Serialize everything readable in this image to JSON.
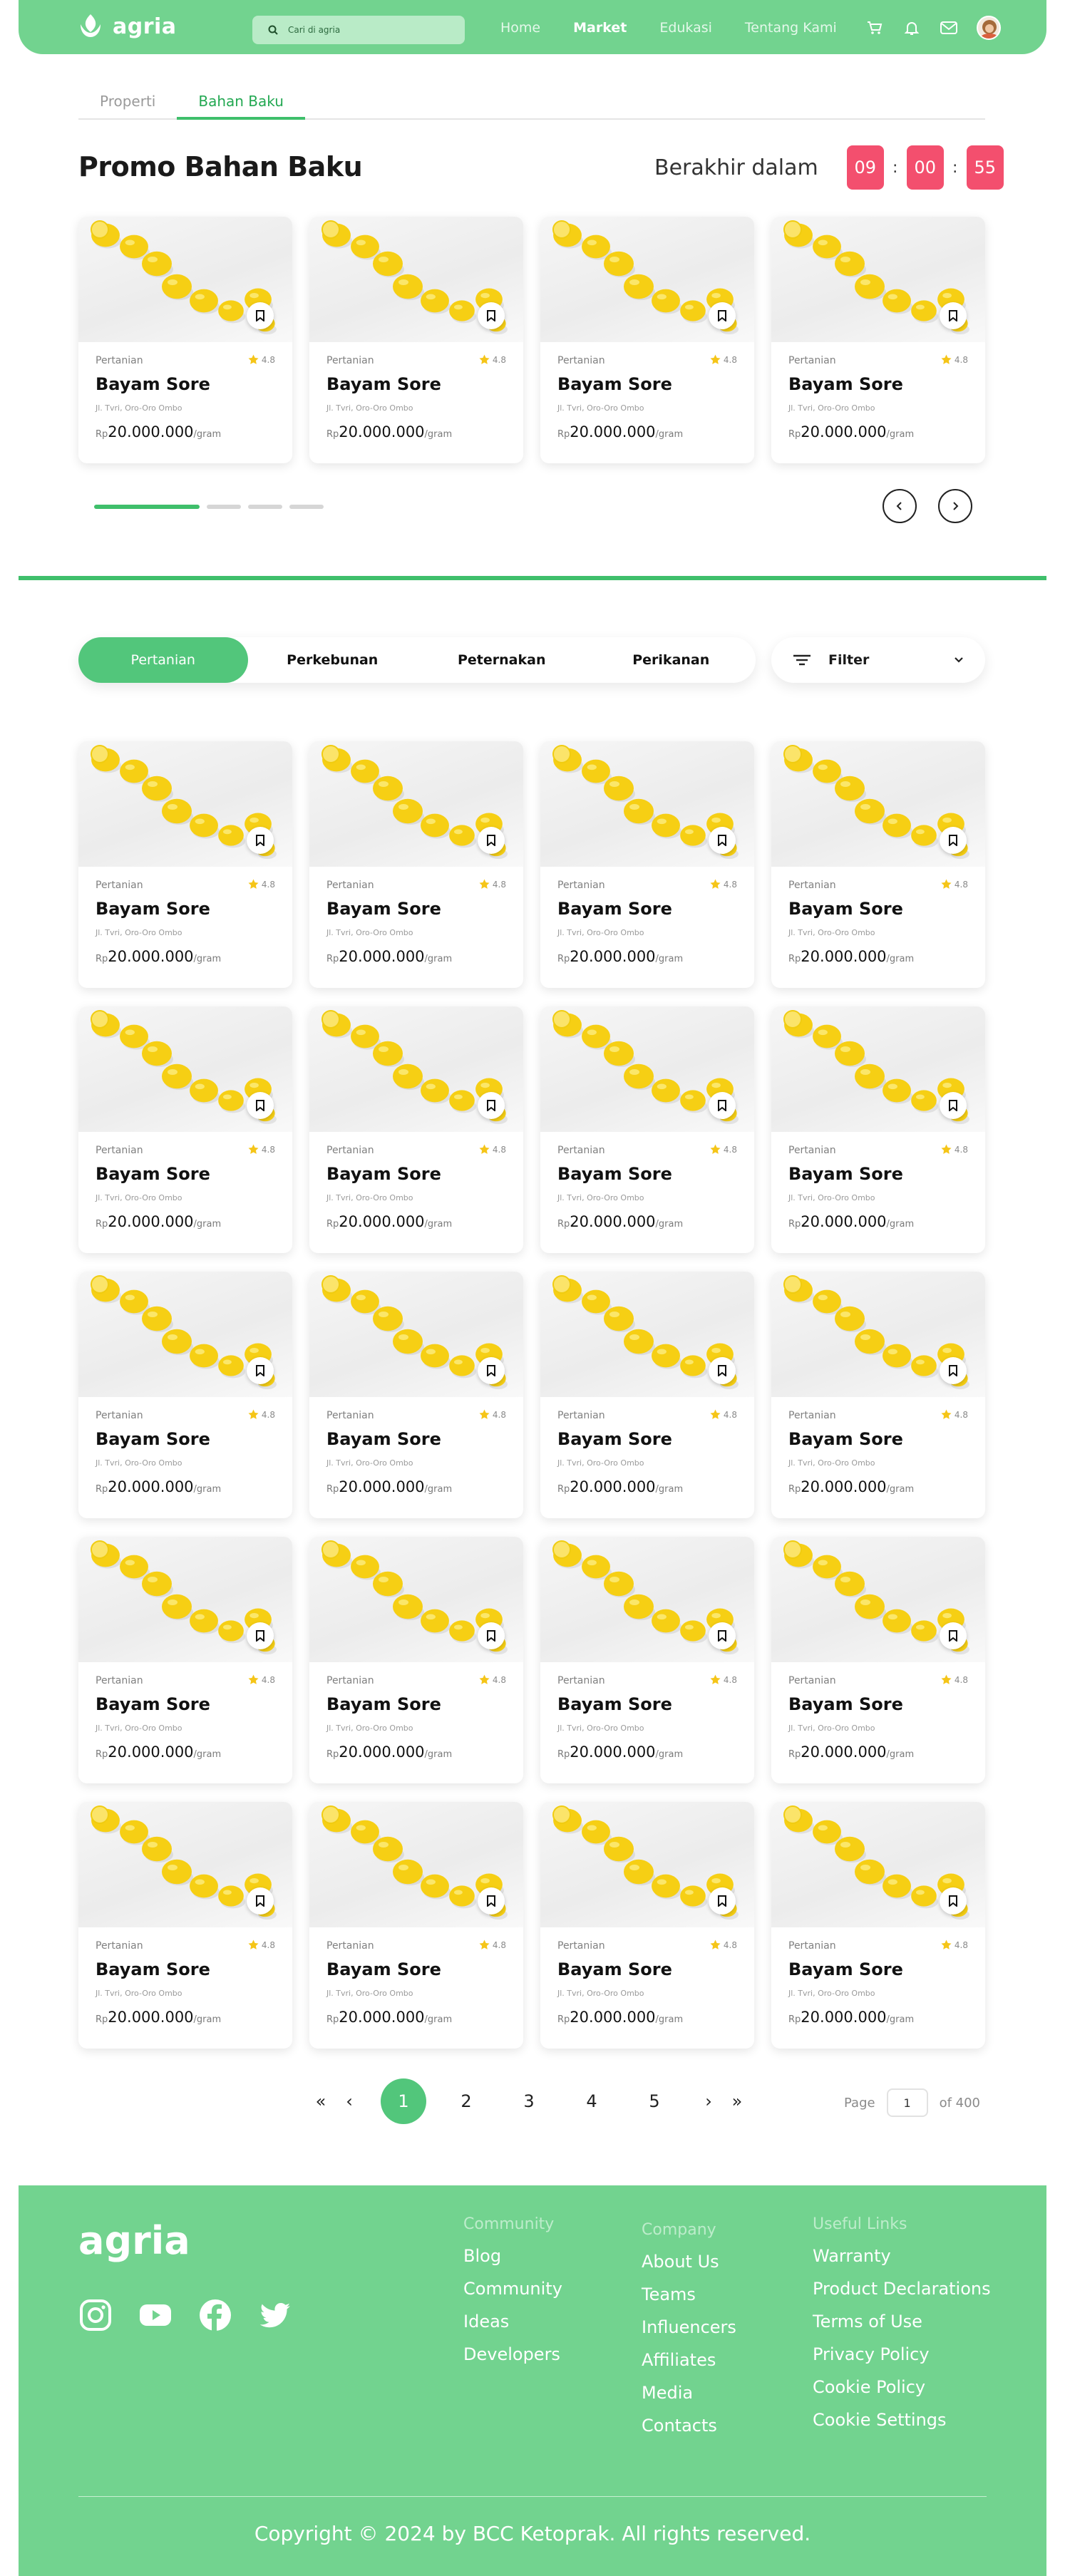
{
  "nav": {
    "brand": "agria",
    "search_placeholder": "Cari di agria",
    "menu": [
      "Home",
      "Market",
      "Edukasi",
      "Tentang Kami"
    ],
    "active_menu": "Market"
  },
  "tabs": [
    "Properti",
    "Bahan Baku"
  ],
  "promo": {
    "title": "Promo Bahan Baku",
    "ends_label": "Berakhir dalam",
    "hours": "09",
    "minutes": "00",
    "seconds": "55",
    "separator": ":"
  },
  "product": {
    "category": "Pertanian",
    "rating": "4.8",
    "name": "Bayam Sore",
    "address": "Jl. Tvri, Oro-Oro Ombo",
    "currency": "Rp",
    "price": "20.000.000",
    "unit": "/gram"
  },
  "promo_card_count": 4,
  "grid_card_count": 20,
  "categories": [
    "Pertanian",
    "Perkebunan",
    "Peternakan",
    "Perikanan"
  ],
  "filter_label": "Filter",
  "pagination": {
    "first": "«",
    "prev": "‹",
    "pages": [
      "1",
      "2",
      "3",
      "4",
      "5"
    ],
    "current": "1",
    "next": "›",
    "last": "»",
    "page_label": "Page",
    "page_value": "1",
    "of_label": "of 400"
  },
  "footer": {
    "logo": "agria",
    "community": {
      "heading": "Community",
      "items": [
        "Blog",
        "Community",
        "Ideas",
        "Developers"
      ]
    },
    "company": {
      "heading": "Company",
      "items": [
        "About Us",
        "Teams",
        "Influencers",
        "Affiliates",
        "Media",
        "Contacts"
      ]
    },
    "useful": {
      "heading": "Useful Links",
      "items": [
        "Warranty",
        "Product Declarations",
        "Terms of Use",
        "Privacy Policy",
        "Cookie Policy",
        "Cookie Settings"
      ]
    },
    "copyright": "Copyright © 2024 by BCC Ketoprak. All rights reserved.",
    "socials": [
      "instagram-icon",
      "youtube-icon",
      "facebook-icon",
      "twitter-icon"
    ]
  },
  "colors": {
    "brand_green": "#72d38f",
    "accent_green": "#3fbf6b",
    "timer_red": "#f34f6e",
    "star": "#f5c518"
  }
}
